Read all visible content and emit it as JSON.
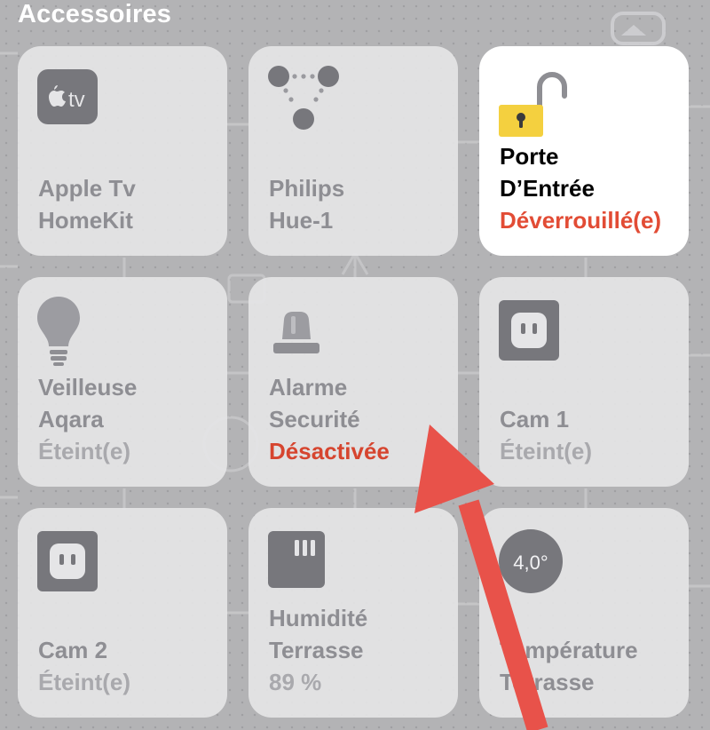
{
  "section": {
    "title": "Accessoires"
  },
  "tiles": [
    {
      "line1": "Apple Tv",
      "line2": "HomeKit",
      "status": "",
      "icon": "apple-tv-icon"
    },
    {
      "line1": "Philips",
      "line2": "Hue-1",
      "status": "",
      "icon": "hue-bridge-icon"
    },
    {
      "line1": "Porte",
      "line2": "D’Entrée",
      "status": "Déverrouillé(e)",
      "icon": "lock-open-icon"
    },
    {
      "line1": "Veilleuse",
      "line2": "Aqara",
      "status": "Éteint(e)",
      "icon": "lightbulb-icon"
    },
    {
      "line1": "Alarme",
      "line2": "Securité",
      "status": "Désactivée",
      "icon": "alarm-siren-icon"
    },
    {
      "line1": "Cam 1",
      "line2": "",
      "status": "Éteint(e)",
      "icon": "outlet-icon"
    },
    {
      "line1": "Cam 2",
      "line2": "",
      "status": "Éteint(e)",
      "icon": "outlet-icon"
    },
    {
      "line1": "Humidité",
      "line2": "Terrasse",
      "status": "89 %",
      "icon": "humidity-sensor-icon"
    },
    {
      "line1": "Température",
      "line2": "Terrasse",
      "status": "",
      "icon": "temperature-icon",
      "badge": "4,0°"
    }
  ],
  "icons": {
    "apple_tv_label": "tv"
  },
  "colors": {
    "tile_bg": "#e5e5e7",
    "tile_active_bg": "#ffffff",
    "alert_red": "#d6452f",
    "lock_yellow": "#f4d03f",
    "annotation_arrow": "#e8524a"
  }
}
